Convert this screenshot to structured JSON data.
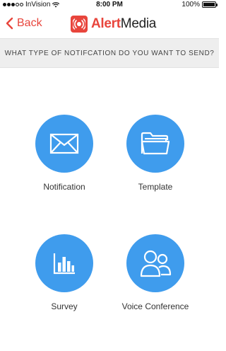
{
  "status_bar": {
    "carrier": "InVision",
    "time": "8:00 PM",
    "battery": "100%",
    "battery_level": 1.0,
    "icons": [
      "signal-dots-icon",
      "wifi-icon",
      "battery-icon"
    ]
  },
  "nav": {
    "back_label": "Back",
    "brand_prefix": "Alert",
    "brand_suffix": "Media",
    "icons": [
      "chevron-left-icon",
      "alertmedia-logo-icon"
    ]
  },
  "question": "WHAT TYPE OF NOTIFCATION DO YOU WANT TO SEND?",
  "options": [
    {
      "label": "Notification",
      "icon": "envelope-icon"
    },
    {
      "label": "Template",
      "icon": "folder-icon"
    },
    {
      "label": "Survey",
      "icon": "bar-chart-icon"
    },
    {
      "label": "Voice Conference",
      "icon": "users-icon"
    }
  ],
  "colors": {
    "accent_red": "#e8453c",
    "option_blue": "#3f9ced",
    "question_band_bg": "#eeeeee"
  }
}
